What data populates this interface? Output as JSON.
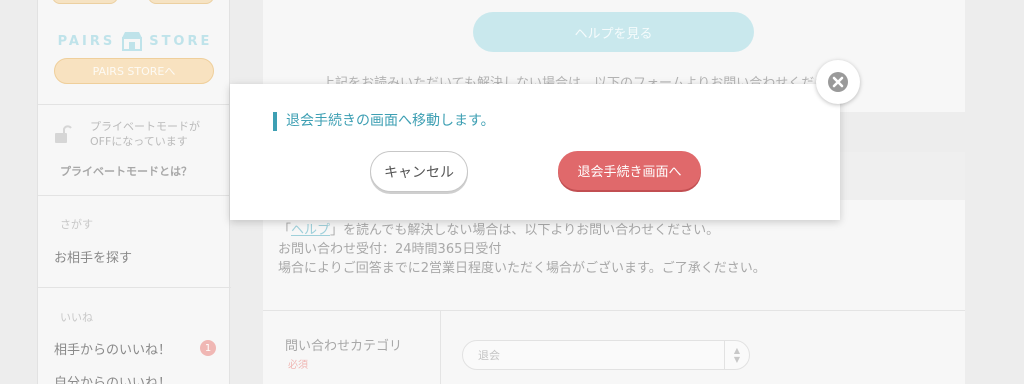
{
  "sidebar": {
    "store_logo_text_left": "PAIRS",
    "store_logo_text_right": "STORE",
    "store_button_label": "PAIRS STOREへ",
    "private_mode_status": "プライベートモードがOFFになっています",
    "private_mode_link": "プライベートモードとは？",
    "search_section": "さがす",
    "search_item": "お相手を探す",
    "likes_section": "いいね",
    "likes_received": "相手からのいいね！",
    "likes_received_badge": "1",
    "likes_sent": "自分からのいいね！"
  },
  "main": {
    "help_button_label": "ヘルプを見る",
    "form_lead": "上記をお読みいただいても解決しない場合は、以下のフォームよりお問い合わせください。",
    "help_note_prefix": "「",
    "help_note_link": "ヘルプ",
    "help_note_suffix": "」を読んでも解決しない場合は、以下よりお問い合わせください。",
    "help_note_line2": "お問い合わせ受付：24時間365日受付",
    "help_note_line3": "場合によりご回答までに2営業日程度いただく場合がございます。ご了承ください。",
    "category_label": "問い合わせカテゴリ",
    "category_required": "必須",
    "category_select_value": "退会"
  },
  "modal": {
    "title": "退会手続きの画面へ移動します。",
    "cancel_label": "キャンセル",
    "proceed_label": "退会手続き画面へ"
  },
  "colors": {
    "accent_teal": "#3d9fb3",
    "danger_red": "#e0696b",
    "store_orange": "#f8e2c0"
  }
}
